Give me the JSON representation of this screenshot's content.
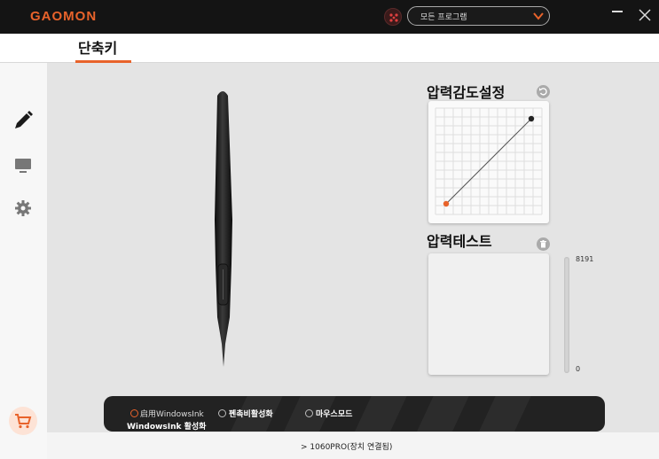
{
  "titlebar": {
    "logo": "GAOMON",
    "program_select": "모든 프로그램"
  },
  "header": {
    "tab_label": "단축키"
  },
  "sidebar": {
    "items": [
      {
        "icon": "pen-icon"
      },
      {
        "icon": "monitor-icon"
      },
      {
        "icon": "gear-icon"
      }
    ],
    "cart_icon": "cart-icon"
  },
  "pressure_sensitivity": {
    "title": "압력감도설정",
    "curve_points": [
      [
        0.1,
        0.1
      ],
      [
        0.9,
        0.9
      ]
    ]
  },
  "pressure_test": {
    "title": "압력테스트",
    "max_label": "8191",
    "min_label": "0",
    "level": 0
  },
  "mode_bar": {
    "enable_windows_ink": "启用WindowsInk",
    "windows_ink_label": "WindowsInk 활성화",
    "disable_pressure": "펜촉비활성화",
    "mouse_mode": "마우스모드"
  },
  "footer": {
    "device_status": "1060PRO(장치 연결됨)"
  },
  "colors": {
    "accent": "#e8632b",
    "titlebar": "#141414"
  }
}
